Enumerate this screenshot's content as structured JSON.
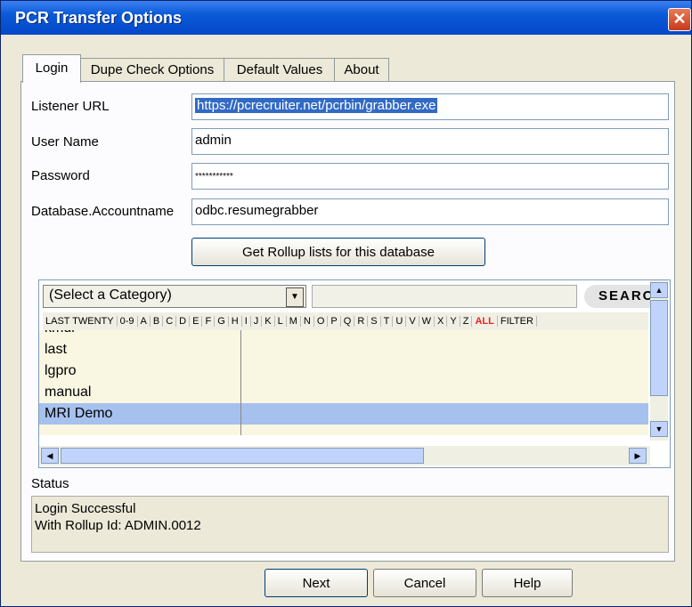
{
  "window": {
    "title": "PCR Transfer Options",
    "close_label": "✕"
  },
  "tabs": [
    {
      "label": "Login"
    },
    {
      "label": "Dupe Check Options"
    },
    {
      "label": "Default Values"
    },
    {
      "label": "About"
    }
  ],
  "form": {
    "listener_url_label": "Listener URL",
    "listener_url_value": "https://pcrecruiter.net/pcrbin/grabber.exe",
    "user_name_label": "User Name",
    "user_name_value": "admin",
    "password_label": "Password",
    "password_value": "***********",
    "account_label": "Database.Accountname",
    "account_value": "odbc.resumegrabber",
    "rollup_button": "Get Rollup lists for this database"
  },
  "browser": {
    "category_select": "(Select a Category)",
    "search_button": "SEARCH",
    "alpha_filters": [
      "LAST TWENTY",
      "0-9",
      "A",
      "B",
      "C",
      "D",
      "E",
      "F",
      "G",
      "H",
      "I",
      "J",
      "K",
      "L",
      "M",
      "N",
      "O",
      "P",
      "Q",
      "R",
      "S",
      "T",
      "U",
      "V",
      "W",
      "X",
      "Y",
      "Z",
      "ALL",
      "FILTER"
    ],
    "list_items": [
      {
        "label": "kmdi",
        "selected": false
      },
      {
        "label": "last",
        "selected": false
      },
      {
        "label": "lgpro",
        "selected": false
      },
      {
        "label": "manual",
        "selected": false
      },
      {
        "label": "MRI Demo",
        "selected": true
      }
    ]
  },
  "status": {
    "label": "Status",
    "line1": "Login Successful",
    "line2": "With Rollup Id: ADMIN.0012"
  },
  "footer": {
    "next": "Next",
    "cancel": "Cancel",
    "help": "Help"
  },
  "colors": {
    "titlebar": "#0a5ad8",
    "selection": "#a6c1ee",
    "list_bg": "#f9f6e2"
  }
}
